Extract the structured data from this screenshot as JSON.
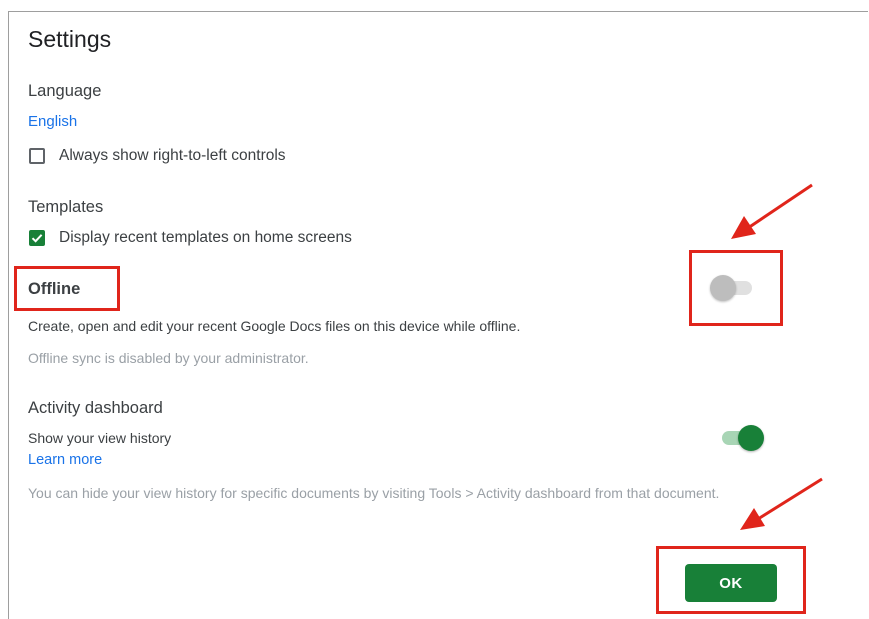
{
  "dialog": {
    "title": "Settings"
  },
  "language": {
    "heading": "Language",
    "value": "English",
    "rtl_checkbox": {
      "label": "Always show right-to-left controls",
      "checked": false
    }
  },
  "templates": {
    "heading": "Templates",
    "recent_checkbox": {
      "label": "Display recent templates on home screens",
      "checked": true
    }
  },
  "offline": {
    "heading": "Offline",
    "description": "Create, open and edit your recent Google Docs files on this device while offline.",
    "note": "Offline sync is disabled by your administrator.",
    "toggle_on": false
  },
  "activity": {
    "heading": "Activity dashboard",
    "view_history_label": "Show your view history",
    "learn_more": "Learn more",
    "note": "You can hide your view history for specific documents by visiting Tools > Activity dashboard from that document.",
    "toggle_on": true
  },
  "footer": {
    "ok_label": "OK"
  },
  "colors": {
    "accent_green": "#188038",
    "link_blue": "#1a73e8",
    "annotation_red": "#e0251b"
  }
}
